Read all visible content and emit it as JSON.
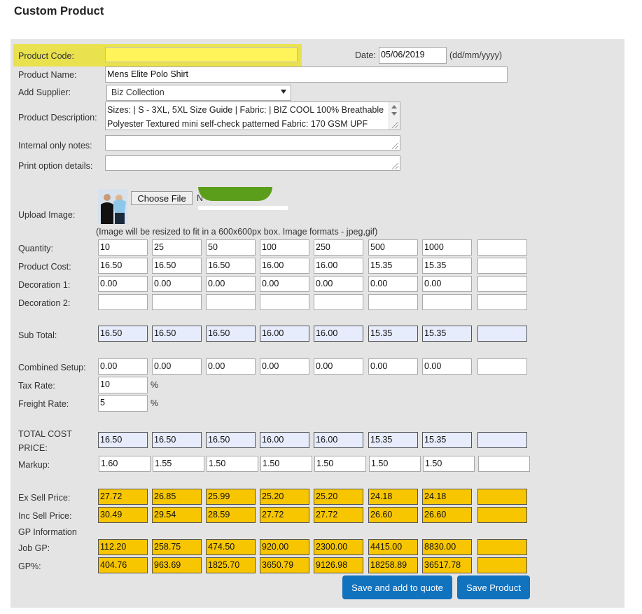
{
  "title": "Custom Product",
  "labels": {
    "product_code": "Product Code:",
    "date": "Date:",
    "date_format": "(dd/mm/yyyy)",
    "product_name": "Product Name:",
    "add_supplier": "Add Supplier:",
    "product_description": "Product Description:",
    "internal_notes": "Internal only notes:",
    "print_option": "Print option details:",
    "upload_image": "Upload Image:",
    "image_note": "(Image will be resized to fit in a 600x600px box. Image formats - jpeg,gif)",
    "quantity": "Quantity:",
    "product_cost": "Product Cost:",
    "decoration1": "Decoration 1:",
    "decoration2": "Decoration 2:",
    "sub_total": "Sub Total:",
    "combined_setup": "Combined Setup:",
    "tax_rate": "Tax Rate:",
    "freight_rate": "Freight Rate:",
    "total_cost_line1": "TOTAL COST",
    "total_cost_line2": "PRICE:",
    "markup": "Markup:",
    "ex_sell": "Ex Sell Price:",
    "inc_sell": "Inc Sell Price:",
    "gp_info": "GP Information",
    "job_gp": "Job GP:",
    "gp_pct": "GP%:",
    "percent": "%"
  },
  "fields": {
    "product_code": "",
    "date": "05/06/2019",
    "product_name": "Mens Elite Polo Shirt",
    "supplier": "Biz Collection",
    "description_line1": "Sizes: | S - 3XL, 5XL Size Guide | Fabric: | BIZ COOL 100% Breathable",
    "description_line2": "Polyester Textured mini self-check patterned Fabric: 170 GSM UPF",
    "internal_notes": "",
    "print_option": "",
    "choose_file": "Choose File",
    "no_file_partial": "N",
    "tax_rate": "10",
    "freight_rate": "5"
  },
  "grid": {
    "quantity": [
      "10",
      "25",
      "50",
      "100",
      "250",
      "500",
      "1000",
      ""
    ],
    "product_cost": [
      "16.50",
      "16.50",
      "16.50",
      "16.00",
      "16.00",
      "15.35",
      "15.35",
      ""
    ],
    "decoration1": [
      "0.00",
      "0.00",
      "0.00",
      "0.00",
      "0.00",
      "0.00",
      "0.00",
      ""
    ],
    "decoration2": [
      "",
      "",
      "",
      "",
      "",
      "",
      "",
      ""
    ],
    "sub_total": [
      "16.50",
      "16.50",
      "16.50",
      "16.00",
      "16.00",
      "15.35",
      "15.35",
      ""
    ],
    "combined_setup": [
      "0.00",
      "0.00",
      "0.00",
      "0.00",
      "0.00",
      "0.00",
      "0.00",
      ""
    ],
    "total_cost": [
      "16.50",
      "16.50",
      "16.50",
      "16.00",
      "16.00",
      "15.35",
      "15.35",
      ""
    ],
    "markup": [
      "1.60",
      "1.55",
      "1.50",
      "1.50",
      "1.50",
      "1.50",
      "1.50",
      ""
    ],
    "ex_sell": [
      "27.72",
      "26.85",
      "25.99",
      "25.20",
      "25.20",
      "24.18",
      "24.18",
      ""
    ],
    "inc_sell": [
      "30.49",
      "29.54",
      "28.59",
      "27.72",
      "27.72",
      "26.60",
      "26.60",
      ""
    ],
    "job_gp": [
      "112.20",
      "258.75",
      "474.50",
      "920.00",
      "2300.00",
      "4415.00",
      "8830.00",
      ""
    ],
    "gp_pct": [
      "404.76",
      "963.69",
      "1825.70",
      "3650.79",
      "9126.98",
      "18258.89",
      "36517.78",
      ""
    ]
  },
  "buttons": {
    "save_add_quote": "Save and add to quote",
    "save_product": "Save Product"
  },
  "colors": {
    "accent": "#1172be",
    "sell_highlight": "#f7c601",
    "subtotal_bg": "#e6ecfb",
    "code_highlight": "#fff45a"
  }
}
